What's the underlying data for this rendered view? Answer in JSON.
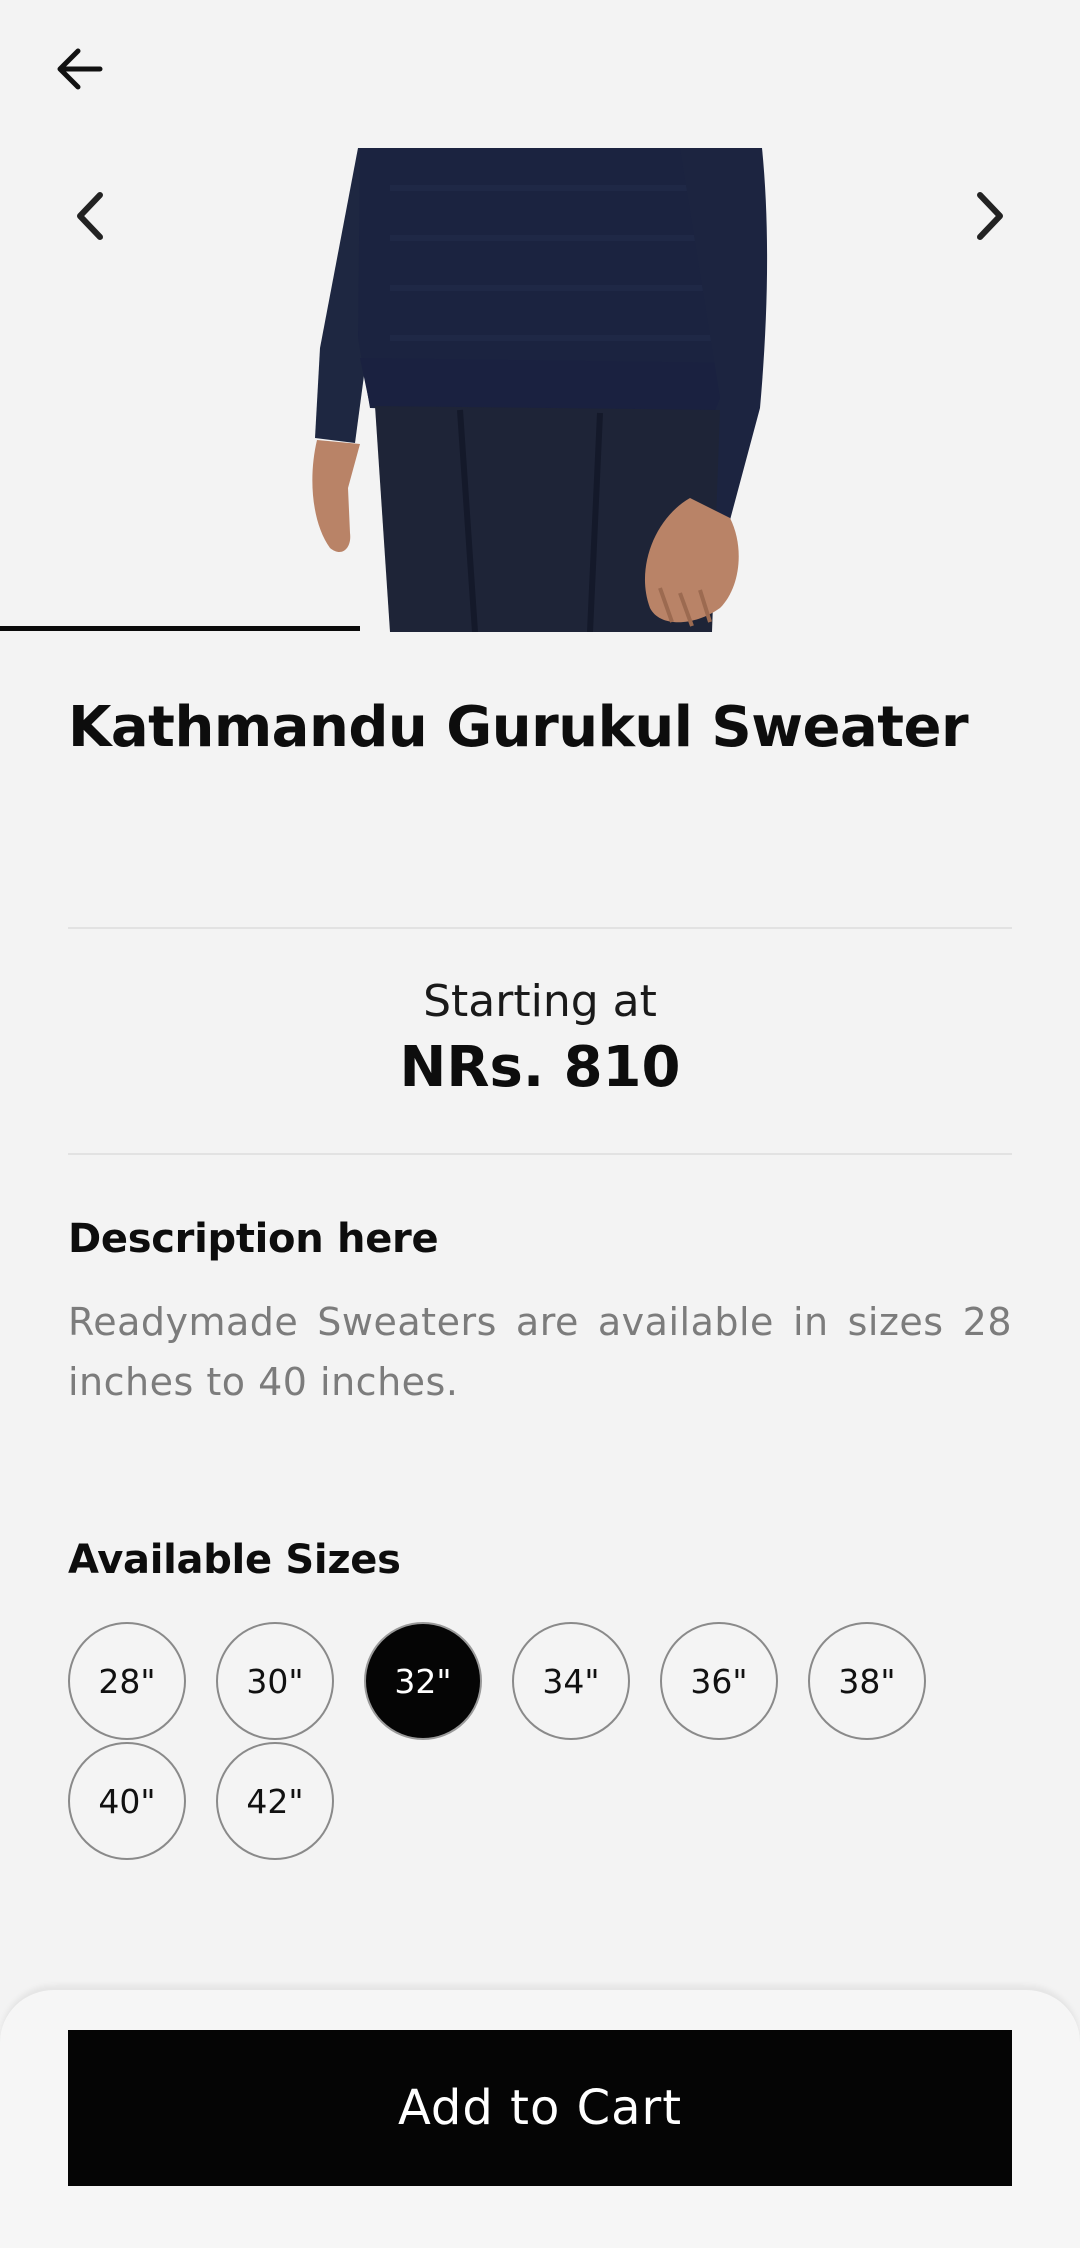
{
  "header": {
    "back_icon": "arrow-left-icon"
  },
  "carousel": {
    "prev_icon": "chevron-left-icon",
    "next_icon": "chevron-right-icon",
    "image_subject": "navy-sweater-photo",
    "progress_fraction": 0.333
  },
  "product": {
    "title": "Kathmandu Gurukul Sweater",
    "price_caption": "Starting at",
    "price": "NRs. 810",
    "description_heading": "Description here",
    "description": "Readymade Sweaters are available in sizes 28 inches to 40 inches.",
    "sizes_heading": "Available Sizes",
    "sizes": [
      "28\"",
      "30\"",
      "32\"",
      "34\"",
      "36\"",
      "38\"",
      "40\"",
      "42\""
    ],
    "selected_size": "32\""
  },
  "actions": {
    "add_to_cart": "Add to Cart"
  },
  "colors": {
    "accent": "#050505",
    "background": "#f3f3f3",
    "muted_text": "#7c7c7c"
  }
}
